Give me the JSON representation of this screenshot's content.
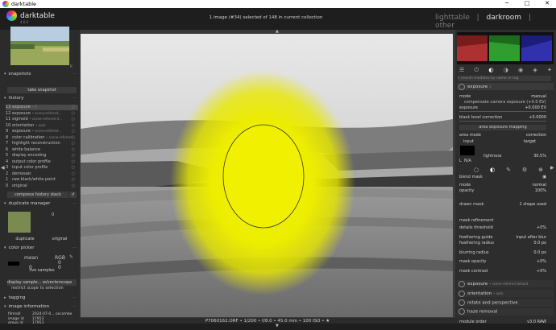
{
  "titlebar": {
    "app": "darktable",
    "minimize": "─",
    "maximize": "□",
    "close": "✕"
  },
  "header": {
    "brand": "darktable",
    "version": "4.6.0",
    "collection_info": "1 image (#34) selected of 148 in current collection",
    "views": [
      "lighttable",
      "|",
      "darkroom",
      "|",
      "other"
    ],
    "active_view": "darkroom"
  },
  "left": {
    "thumb_badge": "R",
    "snapshots": {
      "title": "snapshots",
      "take": "take snapshot"
    },
    "history": {
      "title": "history",
      "items": [
        {
          "n": "13",
          "label": "exposure",
          "sub": "• 1",
          "selected": true
        },
        {
          "n": "12",
          "label": "exposure",
          "sub": "• scene-referred..."
        },
        {
          "n": "11",
          "label": "sigmoid",
          "sub": "• scene-referred d..."
        },
        {
          "n": "10",
          "label": "orientation",
          "sub": "• auto"
        },
        {
          "n": "9",
          "label": "exposure",
          "sub": "• scene-referred..."
        },
        {
          "n": "8",
          "label": "color calibration",
          "sub": "• scene-referred..."
        },
        {
          "n": "7",
          "label": "highlight reconstruction",
          "sub": ""
        },
        {
          "n": "6",
          "label": "white balance",
          "sub": ""
        },
        {
          "n": "5",
          "label": "display encoding",
          "sub": ""
        },
        {
          "n": "4",
          "label": "output color profile",
          "sub": ""
        },
        {
          "n": "3",
          "label": "input color profile",
          "sub": ""
        },
        {
          "n": "2",
          "label": "demosaic",
          "sub": ""
        },
        {
          "n": "1",
          "label": "raw black/white point",
          "sub": ""
        },
        {
          "n": "0",
          "label": "original",
          "sub": ""
        }
      ],
      "compress": "compress history stack"
    },
    "duplicate": {
      "title": "duplicate manager",
      "count": "0",
      "duplicate": "duplicate",
      "original": "original"
    },
    "color_picker": {
      "title": "color picker",
      "mode": "mean",
      "space": "RGB",
      "v1": "0",
      "v2": "0",
      "v3": "0",
      "live": "live samples",
      "display_samples": "display sample... w/vectorscope",
      "restrict": "restrict scope to selection"
    },
    "tagging": {
      "title": "tagging"
    },
    "image_info": {
      "title": "image information",
      "rows": [
        {
          "k": "filmroll",
          "v": "2024-07-0... oscombe"
        },
        {
          "k": "image id",
          "v": "17953"
        },
        {
          "k": "group id",
          "v": "17953"
        }
      ]
    }
  },
  "center": {
    "status": "P7060162.ORF • 1/200 • f/8.0 • 45.0 mm • 100 ISO • ★"
  },
  "right": {
    "search_placeholder": "search modules by name or tag",
    "module_title": "exposure",
    "module_instance": "1",
    "mode_label": "mode",
    "mode_value": "manual",
    "compensate": "compensate camera exposure (+0.0 EV)",
    "exposure_label": "exposure",
    "exposure_value": "+0.000 EV",
    "black_label": "black level correction",
    "black_value": "+0.0000",
    "area_mapping": "area exposure mapping",
    "area_mode_label": "area mode",
    "area_mode_value": "correction",
    "input_label": "input",
    "target_label": "target",
    "lightness_label": "lightness",
    "lightness_value": "30.5%",
    "lab_l": "L",
    "lab_na": "N/A",
    "blend_mask_label": "blend mask",
    "blend_mode_label": "mode",
    "blend_mode_value": "normal",
    "opacity_label": "opacity",
    "opacity_value": "100%",
    "drawn_mask_label": "drawn mask",
    "drawn_mask_value": "1 shape used",
    "refinement": "mask refinement",
    "details_label": "details threshold",
    "details_value": "+0%",
    "feather_guide_label": "feathering guide",
    "feather_guide_value": "input after blur",
    "feather_radius_label": "feathering radius",
    "feather_radius_value": "0.0 px",
    "blur_label": "blurring radius",
    "blur_value": "0.0 px",
    "mask_opacity_label": "mask opacity",
    "mask_opacity_value": "+0%",
    "mask_contrast_label": "mask contrast",
    "mask_contrast_value": "+0%",
    "modules": [
      {
        "label": "exposure",
        "sub": "• scene-referred default"
      },
      {
        "label": "orientation",
        "sub": "• auto"
      },
      {
        "label": "rotate and perspective",
        "sub": ""
      },
      {
        "label": "haze removal",
        "sub": ""
      }
    ],
    "module_order_label": "module order",
    "module_order_value": "v3.0 RAW"
  },
  "colors": {
    "accent": "#e8e800",
    "panel": "#2b2b2b",
    "header": "#1e1e1e"
  }
}
